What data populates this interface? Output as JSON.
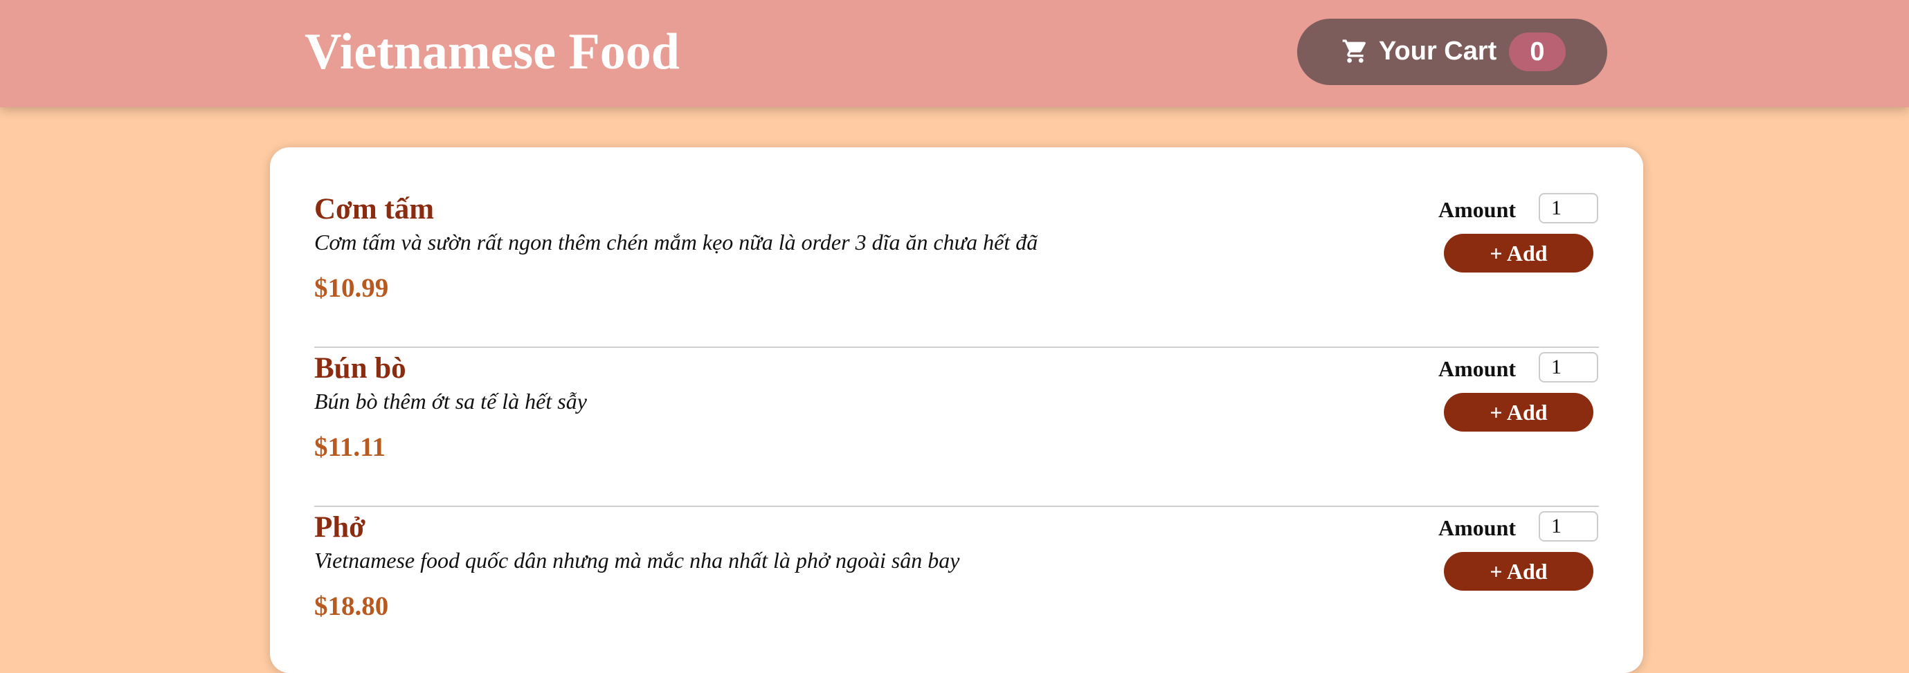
{
  "header": {
    "title": "Vietnamese Food",
    "cart_label": "Your Cart",
    "cart_count": "0",
    "cart_icon": "cart-icon"
  },
  "colors": {
    "header_bg": "#e89e95",
    "page_bg": "#fecba2",
    "cart_button_bg": "#7d5d5c",
    "cart_badge_bg": "#b86273",
    "meal_name": "#8b2c10",
    "meal_price": "#b8591f",
    "add_button_bg": "#8b2c10"
  },
  "meals": [
    {
      "name": "Cơm tấm",
      "description": "Cơm tấm và sườn rất ngon thêm chén mắm kẹo nữa là order 3 dĩa ăn chưa hết đã",
      "price": "$10.99",
      "amount_label": "Amount",
      "amount_value": "1",
      "add_label": "+ Add"
    },
    {
      "name": "Bún bò",
      "description": "Bún bò thêm ớt sa tế là hết sẫy",
      "price": "$11.11",
      "amount_label": "Amount",
      "amount_value": "1",
      "add_label": "+ Add"
    },
    {
      "name": "Phở",
      "description": "Vietnamese food quốc dân nhưng mà mắc nha nhất là phở ngoài sân bay",
      "price": "$18.80",
      "amount_label": "Amount",
      "amount_value": "1",
      "add_label": "+ Add"
    }
  ]
}
